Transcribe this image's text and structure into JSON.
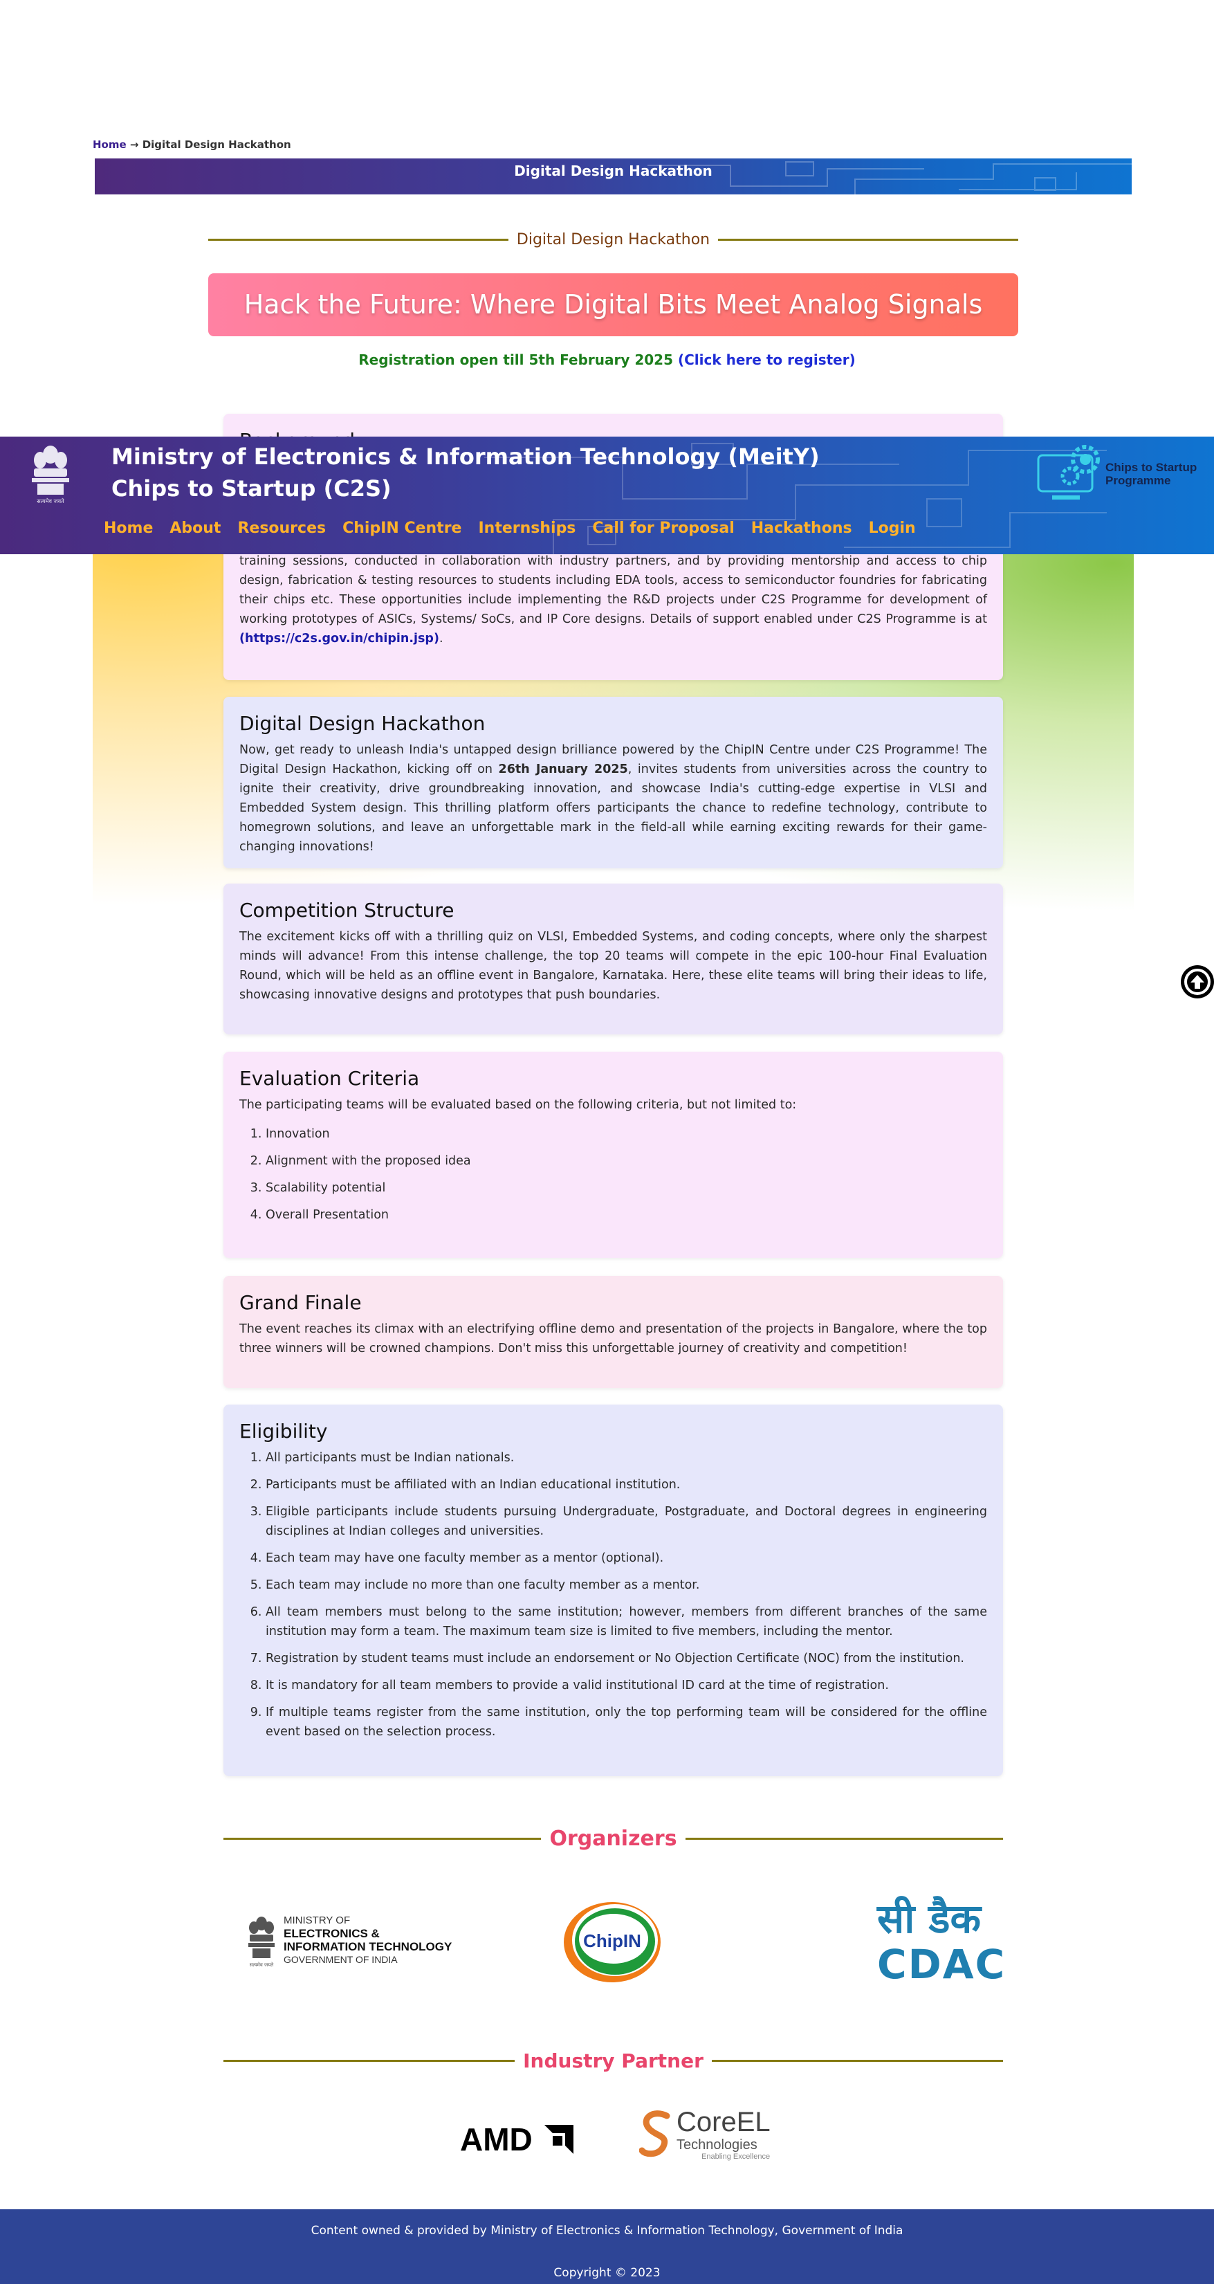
{
  "breadcrumb": {
    "home": "Home",
    "arrow": "→",
    "current": "Digital Design Hackathon"
  },
  "banner": {
    "title": "Digital Design Hackathon"
  },
  "section_title": "Digital Design Hackathon",
  "hero": {
    "tagline": "Hack the Future: Where Digital Bits Meet Analog Signals"
  },
  "registration": {
    "text": "Registration open till 5th February 2025",
    "link": "(Click here to register)"
  },
  "header": {
    "ministry": "Ministry of Electronics & Information Technology (MeitY)",
    "programme": "Chips to Startup (C2S)",
    "nav": [
      "Home",
      "About",
      "Resources",
      "ChipIN Centre",
      "Internships",
      "Call for Proposal",
      "Hackathons",
      "Login"
    ],
    "logo_text_1": "Chips to Startup",
    "logo_text_2": "Programme"
  },
  "background_card": {
    "heading": "Background",
    "text": "training sessions, conducted in collaboration with industry partners, and by providing mentorship and access to chip design, fabrication & testing resources to students including EDA tools, access to semiconductor foundries for fabricating their chips etc. These opportunities include implementing the R&D projects under C2S Programme for development of working prototypes of ASICs, Systems/ SoCs, and IP Core designs. Details of support enabled under C2S Programme is at",
    "link": "(https://c2s.gov.in/chipin.jsp)",
    "end": "."
  },
  "hackathon_card": {
    "heading": "Digital Design Hackathon",
    "text_1": "Now, get ready to unleash India's untapped design brilliance powered by the ChipIN Centre under C2S Programme! The Digital Design Hackathon, kicking off on ",
    "date": "26th January 2025",
    "text_2": ", invites students from universities across the country to ignite their creativity, drive groundbreaking innovation, and showcase India's cutting-edge expertise in VLSI and Embedded System design. This thrilling platform offers participants the chance to redefine technology, contribute to homegrown solutions, and leave an unforgettable mark in the field-all while earning exciting rewards for their game-changing innovations!"
  },
  "structure_card": {
    "heading": "Competition Structure",
    "text": "The excitement kicks off with a thrilling quiz on VLSI, Embedded Systems, and coding concepts, where only the sharpest minds will advance! From this intense challenge, the top 20 teams will compete in the epic 100-hour Final Evaluation Round, which will be held as an offline event in Bangalore, Karnataka. Here, these elite teams will bring their ideas to life, showcasing innovative designs and prototypes that push boundaries."
  },
  "evaluation_card": {
    "heading": "Evaluation Criteria",
    "intro": "The participating teams will be evaluated based on the following criteria, but not limited to:",
    "items": [
      "Innovation",
      "Alignment with the proposed idea",
      "Scalability potential",
      "Overall Presentation"
    ]
  },
  "finale_card": {
    "heading": "Grand Finale",
    "text": "The event reaches its climax with an electrifying offline demo and presentation of the projects in Bangalore, where the top three winners will be crowned champions. Don't miss this unforgettable journey of creativity and competition!"
  },
  "eligibility_card": {
    "heading": "Eligibility",
    "items": [
      "All participants must be Indian nationals.",
      "Participants must be affiliated with an Indian educational institution.",
      "Eligible participants include students pursuing Undergraduate, Postgraduate, and Doctoral degrees in engineering disciplines at Indian colleges and universities.",
      "Each team may have one faculty member as a mentor (optional).",
      "Each team may include no more than one faculty member as a mentor.",
      "All team members must belong to the same institution; however, members from different branches of the same institution may form a team. The maximum team size is limited to five members, including the mentor.",
      "Registration by student teams must include an endorsement or No Objection Certificate (NOC) from the institution.",
      "It is mandatory for all team members to provide a valid institutional ID card at the time of registration.",
      "If multiple teams register from the same institution, only the top performing team will be considered for the offline event based on the selection process."
    ]
  },
  "organizers": {
    "title": "Organizers",
    "meity_logo": [
      "MINISTRY OF",
      "ELECTRONICS &",
      "INFORMATION TECHNOLOGY",
      "GOVERNMENT OF INDIA"
    ],
    "chipin_logo": "ChipIN",
    "cdac_logo": [
      "सी डैक",
      "CDAC"
    ]
  },
  "industry": {
    "title": "Industry Partner",
    "amd_logo": "AMD",
    "coreel_logo": [
      "CoreEL",
      "Technologies",
      "Enabling Excellence"
    ]
  },
  "footer": {
    "line1": "Content owned & provided by Ministry of Electronics & Information Technology, Government of India",
    "line2": "Copyright © 2023"
  },
  "colors": {
    "accent_gold": "#857a12",
    "nav_orange": "#ffb12b",
    "section_pink": "#e8456b",
    "footer_blue": "#2e4596"
  }
}
